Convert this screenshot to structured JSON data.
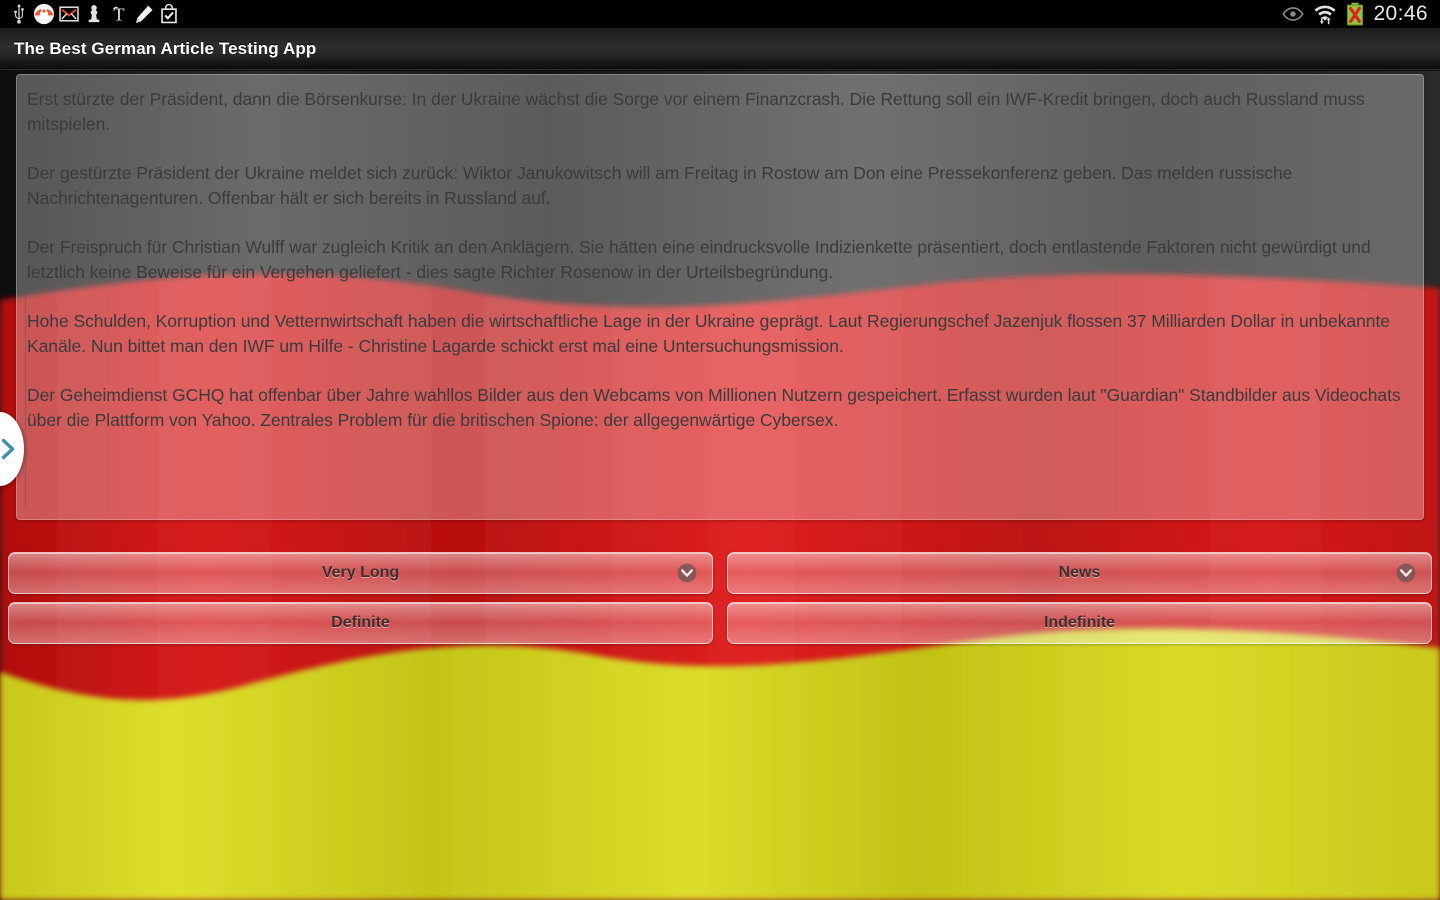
{
  "statusbar": {
    "left_icons": [
      {
        "name": "usb-icon",
        "label": "USB"
      },
      {
        "name": "keyguard-lock-icon",
        "label": "Lock"
      },
      {
        "name": "gmail-icon",
        "label": "Gmail"
      },
      {
        "name": "chess-pawn-icon",
        "label": "Chess"
      },
      {
        "name": "nytimes-icon",
        "label": "NYTimes"
      },
      {
        "name": "pen-icon",
        "label": "Note"
      },
      {
        "name": "checklist-bag-icon",
        "label": "Tasks"
      }
    ],
    "right_icons": [
      {
        "name": "eye-icon",
        "label": "Smart stay"
      },
      {
        "name": "wifi-icon",
        "label": "Wi-Fi"
      },
      {
        "name": "battery-error-icon",
        "label": "Battery"
      }
    ],
    "clock": "20:46"
  },
  "actionbar": {
    "title": "The Best German Article Testing App"
  },
  "drawer": {
    "handle_icon": "chevron-right-icon",
    "handle_color": "#3c90b0"
  },
  "content": {
    "paragraphs": [
      "Erst stürzte der Präsident, dann die Börsenkurse: In der Ukraine wächst die Sorge vor einem Finanzcrash. Die Rettung soll ein IWF-Kredit bringen, doch auch Russland muss mitspielen.",
      "Der gestürzte Präsident der Ukraine meldet sich zurück: Wiktor Janukowitsch will am Freitag in Rostow am Don eine Pressekonferenz geben. Das melden russische Nachrichtenagenturen. Offenbar hält er sich bereits in Russland auf.",
      "Der Freispruch für Christian Wulff war zugleich Kritik an den Anklägern. Sie hätten eine eindrucksvolle Indizienkette präsentiert, doch entlastende Faktoren nicht gewürdigt und letztlich keine Beweise für ein Vergehen geliefert - dies sagte Richter Rosenow in der Urteilsbegründung.",
      "Hohe Schulden, Korruption und Vetternwirtschaft haben die wirtschaftliche Lage in der Ukraine geprägt. Laut Regierungschef Jazenjuk flossen 37 Milliarden Dollar in unbekannte Kanäle. Nun bittet man den IWF um Hilfe - Christine Lagarde schickt erst mal eine Untersuchungsmission.",
      "Der Geheimdienst GCHQ hat offenbar über Jahre wahllos Bilder aus den Webcams von Millionen Nutzern gespeichert. Erfasst wurden laut \"Guardian\" Standbilder aus Videochats über die Plattform von Yahoo. Zentrales Problem für die britischen Spione: der allgegenwärtige Cybersex."
    ]
  },
  "controls": {
    "length_spinner": {
      "value": "Very Long",
      "icon": "chevron-down-icon"
    },
    "category_spinner": {
      "value": "News",
      "icon": "chevron-down-icon"
    },
    "definite_button": {
      "label": "Definite"
    },
    "indefinite_button": {
      "label": "Indefinite"
    }
  },
  "theme": {
    "flag_black": "#1c1c1c",
    "flag_red": "#cc1111",
    "flag_gold": "#d4d420",
    "card_text": "#3b3b3b",
    "button_text": "#3c2f2f"
  }
}
